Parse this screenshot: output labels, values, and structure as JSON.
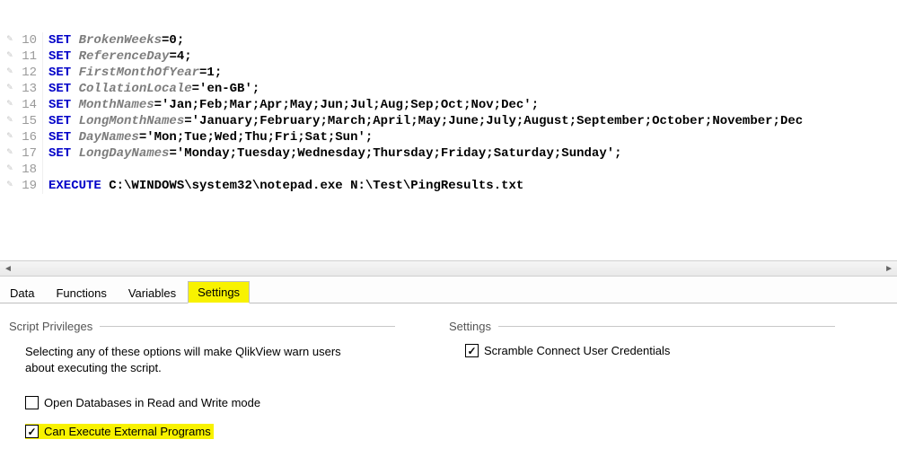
{
  "editor": {
    "lines": [
      {
        "n": 10,
        "kw": "SET ",
        "var": "BrokenWeeks",
        "rest": "=0;"
      },
      {
        "n": 11,
        "kw": "SET ",
        "var": "ReferenceDay",
        "rest": "=4;"
      },
      {
        "n": 12,
        "kw": "SET ",
        "var": "FirstMonthOfYear",
        "rest": "=1;"
      },
      {
        "n": 13,
        "kw": "SET ",
        "var": "CollationLocale",
        "rest": "='en-GB';"
      },
      {
        "n": 14,
        "kw": "SET ",
        "var": "MonthNames",
        "rest": "='Jan;Feb;Mar;Apr;May;Jun;Jul;Aug;Sep;Oct;Nov;Dec';"
      },
      {
        "n": 15,
        "kw": "SET ",
        "var": "LongMonthNames",
        "rest": "='January;February;March;April;May;June;July;August;September;October;November;Dec"
      },
      {
        "n": 16,
        "kw": "SET ",
        "var": "DayNames",
        "rest": "='Mon;Tue;Wed;Thu;Fri;Sat;Sun';"
      },
      {
        "n": 17,
        "kw": "SET ",
        "var": "LongDayNames",
        "rest": "='Monday;Tuesday;Wednesday;Thursday;Friday;Saturday;Sunday';"
      },
      {
        "n": 18,
        "kw": "",
        "var": "",
        "rest": ""
      },
      {
        "n": 19,
        "kw": "EXECUTE ",
        "var": "",
        "rest": "C:\\WINDOWS\\system32\\notepad.exe N:\\Test\\PingResults.txt"
      }
    ]
  },
  "tabs": {
    "items": [
      {
        "label": "Data"
      },
      {
        "label": "Functions"
      },
      {
        "label": "Variables"
      },
      {
        "label": "Settings"
      }
    ],
    "activeIndex": 3
  },
  "panel": {
    "left": {
      "title": "Script Privileges",
      "desc": "Selecting any of these options will make QlikView warn users about executing the script.",
      "cb1_label": "Open Databases in Read and Write mode",
      "cb1_checked": false,
      "cb2_label": "Can Execute External Programs",
      "cb2_checked": true
    },
    "right": {
      "title": "Settings",
      "cb1_label": "Scramble Connect User Credentials",
      "cb1_checked": true
    }
  }
}
